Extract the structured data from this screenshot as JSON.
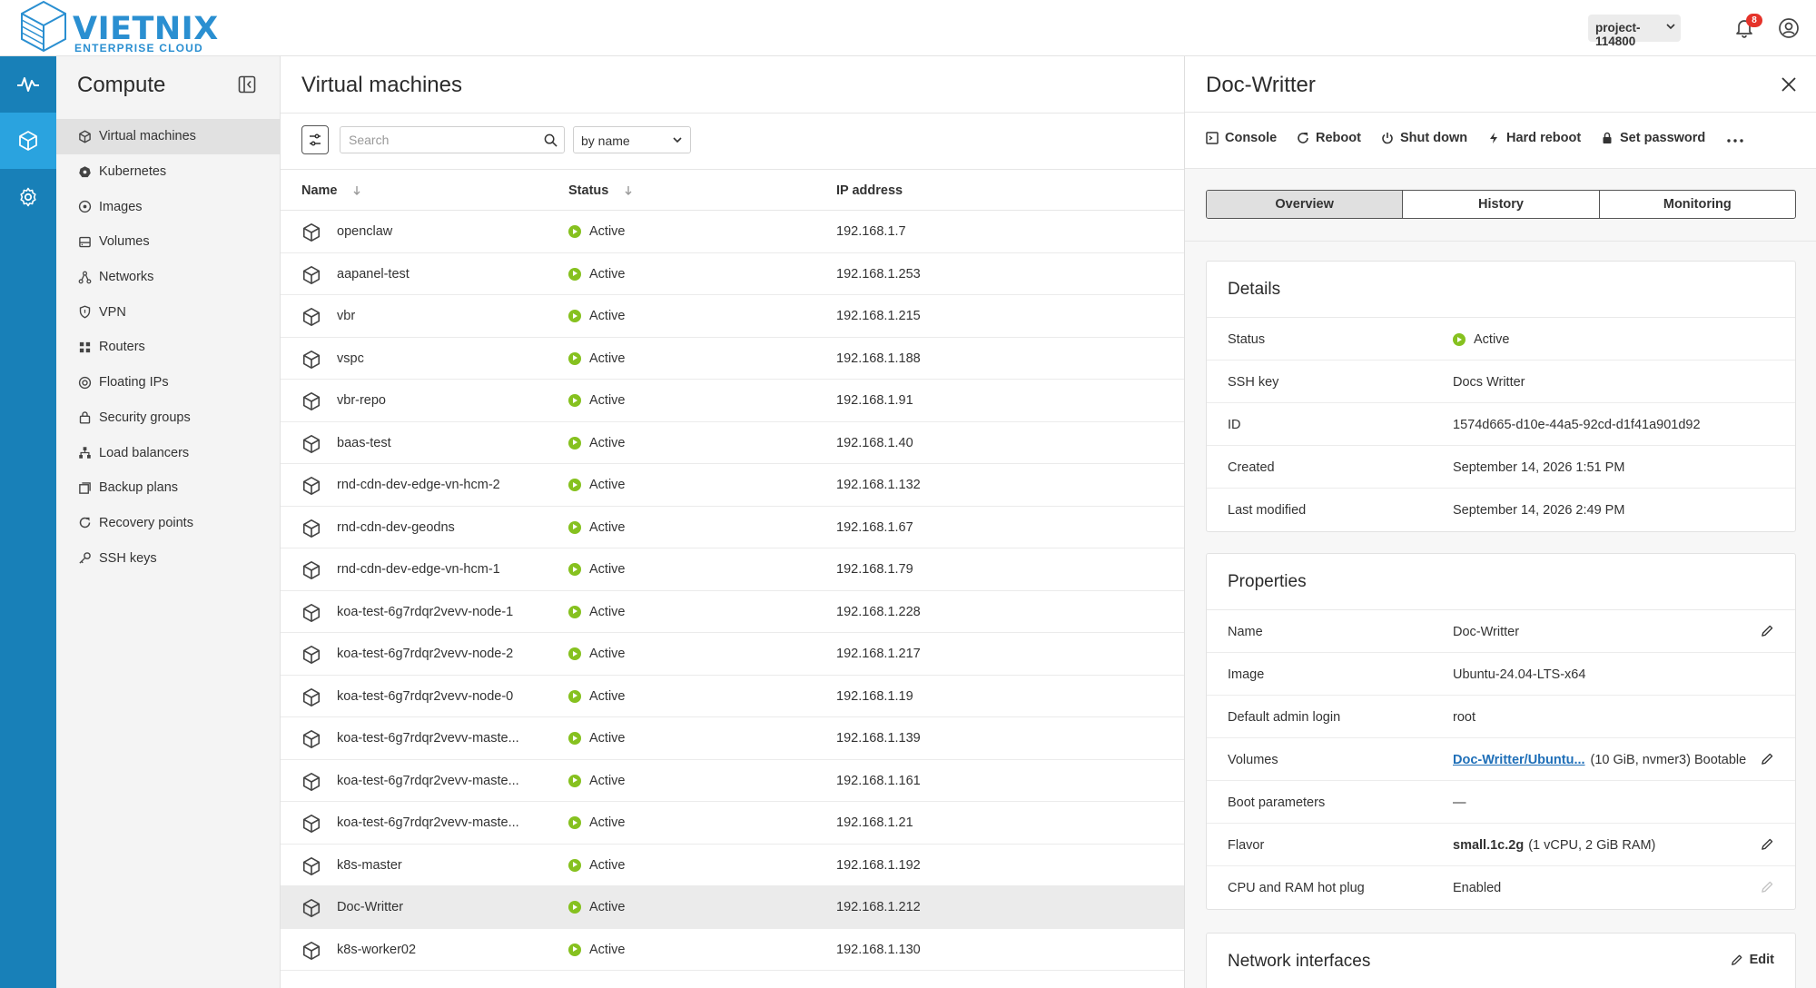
{
  "brand": {
    "name": "VIETNIX",
    "tagline": "ENTERPRISE CLOUD"
  },
  "header": {
    "project": "project-114800",
    "notifications_count": "8"
  },
  "rail": [
    {
      "icon": "activity-icon",
      "active": false
    },
    {
      "icon": "cube-icon",
      "active": true
    },
    {
      "icon": "gear-icon",
      "active": false
    }
  ],
  "sidebar": {
    "title": "Compute",
    "items": [
      {
        "label": "Virtual machines",
        "icon": "cube-icon",
        "active": true
      },
      {
        "label": "Kubernetes",
        "icon": "kubernetes-icon"
      },
      {
        "label": "Images",
        "icon": "disc-icon"
      },
      {
        "label": "Volumes",
        "icon": "volume-icon"
      },
      {
        "label": "Networks",
        "icon": "network-icon"
      },
      {
        "label": "VPN",
        "icon": "shield-icon"
      },
      {
        "label": "Routers",
        "icon": "router-icon"
      },
      {
        "label": "Floating IPs",
        "icon": "floating-ip-icon"
      },
      {
        "label": "Security groups",
        "icon": "lock-icon"
      },
      {
        "label": "Load balancers",
        "icon": "load-balancer-icon"
      },
      {
        "label": "Backup plans",
        "icon": "backup-icon"
      },
      {
        "label": "Recovery points",
        "icon": "recovery-icon"
      },
      {
        "label": "SSH keys",
        "icon": "key-icon"
      }
    ]
  },
  "main": {
    "title": "Virtual machines",
    "search_placeholder": "Search",
    "sort_value": "by name",
    "columns": {
      "name": "Name",
      "status": "Status",
      "ip": "IP address"
    },
    "rows": [
      {
        "name": "openclaw",
        "status": "Active",
        "ip": "192.168.1.7"
      },
      {
        "name": "aapanel-test",
        "status": "Active",
        "ip": "192.168.1.253"
      },
      {
        "name": "vbr",
        "status": "Active",
        "ip": "192.168.1.215"
      },
      {
        "name": "vspc",
        "status": "Active",
        "ip": "192.168.1.188"
      },
      {
        "name": "vbr-repo",
        "status": "Active",
        "ip": "192.168.1.91"
      },
      {
        "name": "baas-test",
        "status": "Active",
        "ip": "192.168.1.40"
      },
      {
        "name": "rnd-cdn-dev-edge-vn-hcm-2",
        "status": "Active",
        "ip": "192.168.1.132"
      },
      {
        "name": "rnd-cdn-dev-geodns",
        "status": "Active",
        "ip": "192.168.1.67"
      },
      {
        "name": "rnd-cdn-dev-edge-vn-hcm-1",
        "status": "Active",
        "ip": "192.168.1.79"
      },
      {
        "name": "koa-test-6g7rdqr2vevv-node-1",
        "status": "Active",
        "ip": "192.168.1.228"
      },
      {
        "name": "koa-test-6g7rdqr2vevv-node-2",
        "status": "Active",
        "ip": "192.168.1.217"
      },
      {
        "name": "koa-test-6g7rdqr2vevv-node-0",
        "status": "Active",
        "ip": "192.168.1.19"
      },
      {
        "name": "koa-test-6g7rdqr2vevv-maste...",
        "status": "Active",
        "ip": "192.168.1.139"
      },
      {
        "name": "koa-test-6g7rdqr2vevv-maste...",
        "status": "Active",
        "ip": "192.168.1.161"
      },
      {
        "name": "koa-test-6g7rdqr2vevv-maste...",
        "status": "Active",
        "ip": "192.168.1.21"
      },
      {
        "name": "k8s-master",
        "status": "Active",
        "ip": "192.168.1.192"
      },
      {
        "name": "Doc-Writter",
        "status": "Active",
        "ip": "192.168.1.212",
        "selected": true
      },
      {
        "name": "k8s-worker02",
        "status": "Active",
        "ip": "192.168.1.130"
      }
    ]
  },
  "panel": {
    "title": "Doc-Writter",
    "actions": [
      "Console",
      "Reboot",
      "Shut down",
      "Hard reboot",
      "Set password"
    ],
    "tabs": [
      "Overview",
      "History",
      "Monitoring"
    ],
    "active_tab": "Overview",
    "details": {
      "title": "Details",
      "rows": [
        {
          "key": "Status",
          "value": "Active"
        },
        {
          "key": "SSH key",
          "value": "Docs Writter"
        },
        {
          "key": "ID",
          "value": "1574d665-d10e-44a5-92cd-d1f41a901d92"
        },
        {
          "key": "Created",
          "value": "September 14, 2026 1:51 PM"
        },
        {
          "key": "Last modified",
          "value": "September 14, 2026 2:49 PM"
        }
      ]
    },
    "properties": {
      "title": "Properties",
      "name_key": "Name",
      "name_value": "Doc-Writter",
      "image_key": "Image",
      "image_value": "Ubuntu-24.04-LTS-x64",
      "login_key": "Default admin login",
      "login_value": "root",
      "volumes_key": "Volumes",
      "volumes_link": "Doc-Writter/Ubuntu...",
      "volumes_extra": "(10 GiB, nvmer3) Bootable",
      "boot_key": "Boot parameters",
      "boot_value": "—",
      "flavor_key": "Flavor",
      "flavor_bold": "small.1c.2g",
      "flavor_extra": "(1 vCPU, 2 GiB RAM)",
      "hotplug_key": "CPU and RAM hot plug",
      "hotplug_value": "Enabled"
    },
    "network": {
      "title": "Network interfaces",
      "edit_label": "Edit"
    }
  },
  "colors": {
    "rail": "#1880b8",
    "rail_active": "#2aa3df",
    "status_active": "#86c11f",
    "link": "#1f6fb8",
    "badge": "#e5332a"
  }
}
